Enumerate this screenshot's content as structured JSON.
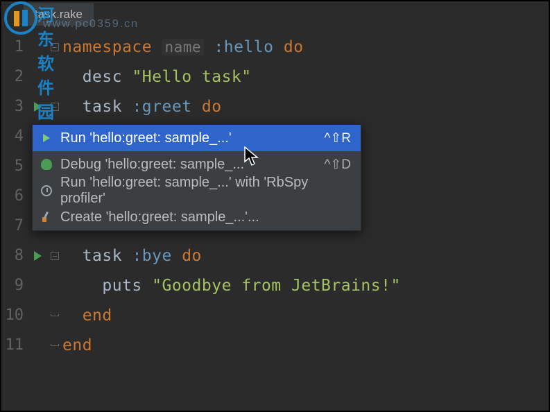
{
  "watermark": {
    "text": "河东软件园",
    "url": "www.pc0359.cn"
  },
  "tab": {
    "filename": "task.rake"
  },
  "code": {
    "lines": [
      {
        "n": "1",
        "run": false,
        "fold": "open",
        "indent": "",
        "tokens": [
          [
            "kw",
            "namespace"
          ],
          [
            "sp",
            " "
          ],
          [
            "hint",
            "name"
          ],
          [
            "sp",
            " "
          ],
          [
            "sym",
            ":hello"
          ],
          [
            "sp",
            " "
          ],
          [
            "kw",
            "do"
          ]
        ]
      },
      {
        "n": "2",
        "run": false,
        "fold": "",
        "indent": "  ",
        "tokens": [
          [
            "id",
            "desc"
          ],
          [
            "sp",
            " "
          ],
          [
            "str",
            "\"Hello task\""
          ]
        ]
      },
      {
        "n": "3",
        "run": true,
        "fold": "open",
        "indent": "  ",
        "tokens": [
          [
            "id",
            "task"
          ],
          [
            "sp",
            " "
          ],
          [
            "sym",
            ":greet"
          ],
          [
            "sp",
            " "
          ],
          [
            "kw",
            "do"
          ]
        ]
      },
      {
        "n": "4",
        "run": false,
        "fold": "",
        "indent": "",
        "tokens": []
      },
      {
        "n": "5",
        "run": false,
        "fold": "",
        "indent": "",
        "tokens": []
      },
      {
        "n": "6",
        "run": false,
        "fold": "",
        "indent": "",
        "tokens": []
      },
      {
        "n": "7",
        "run": false,
        "fold": "",
        "indent": "",
        "tokens": []
      },
      {
        "n": "8",
        "run": true,
        "fold": "open",
        "indent": "  ",
        "tokens": [
          [
            "id",
            "task"
          ],
          [
            "sp",
            " "
          ],
          [
            "sym",
            ":bye"
          ],
          [
            "sp",
            " "
          ],
          [
            "kw",
            "do"
          ]
        ]
      },
      {
        "n": "9",
        "run": false,
        "fold": "",
        "indent": "    ",
        "tokens": [
          [
            "id",
            "puts"
          ],
          [
            "sp",
            " "
          ],
          [
            "str",
            "\"Goodbye from JetBrains!\""
          ]
        ]
      },
      {
        "n": "10",
        "run": false,
        "fold": "close",
        "indent": "  ",
        "tokens": [
          [
            "kw",
            "end"
          ]
        ]
      },
      {
        "n": "11",
        "run": false,
        "fold": "close",
        "indent": "",
        "tokens": [
          [
            "kw",
            "end"
          ]
        ]
      }
    ]
  },
  "menu": {
    "items": [
      {
        "icon": "run",
        "label": "Run 'hello:greet: sample_...'",
        "shortcut": "^⇧R",
        "selected": true
      },
      {
        "icon": "debug",
        "label": "Debug 'hello:greet: sample_...'",
        "shortcut": "^⇧D",
        "selected": false
      },
      {
        "icon": "profile",
        "label": "Run 'hello:greet: sample_...' with 'RbSpy profiler'",
        "shortcut": "",
        "selected": false
      },
      {
        "icon": "create",
        "label": "Create 'hello:greet: sample_...'...",
        "shortcut": "",
        "selected": false
      }
    ]
  }
}
